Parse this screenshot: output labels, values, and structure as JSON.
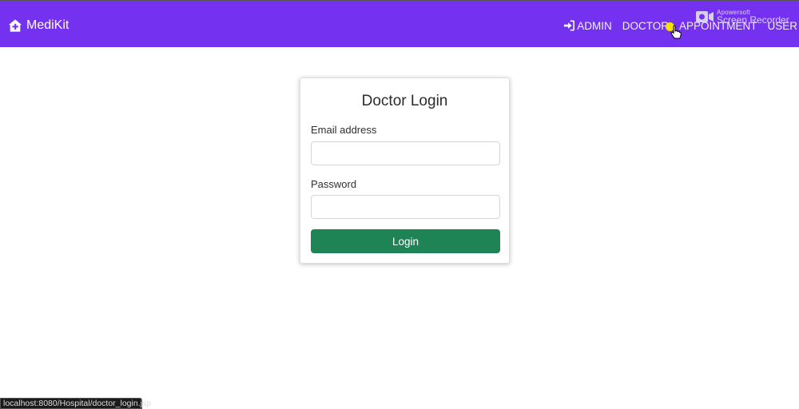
{
  "navbar": {
    "brand": "MediKit",
    "links": [
      {
        "label": "ADMIN",
        "icon": "sign-in-icon"
      },
      {
        "label": "DOCTOR"
      },
      {
        "label": "APPOINTMENT"
      },
      {
        "label": "USER"
      }
    ],
    "color": "#7432f0"
  },
  "watermark": {
    "small": "Apowersoft",
    "big": "Screen Recorder"
  },
  "login_card": {
    "title": "Doctor Login",
    "email_label": "Email address",
    "email_value": "",
    "password_label": "Password",
    "password_value": "",
    "button_label": "Login",
    "button_color": "#1e8455"
  },
  "status_bar": {
    "url": "localhost:8080/Hospital/doctor_login.jsp"
  }
}
